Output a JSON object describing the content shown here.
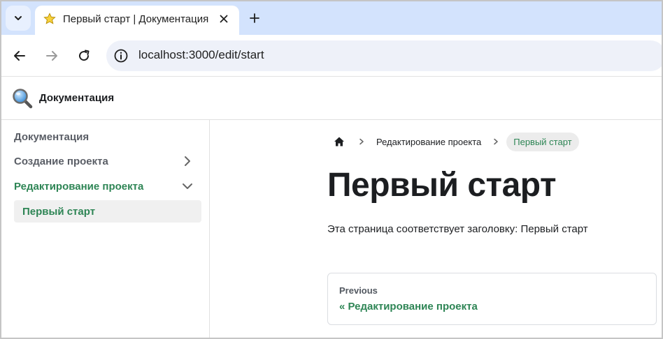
{
  "browser": {
    "tab": {
      "title": "Первый старт | Документация"
    },
    "url": "localhost:3000/edit/start"
  },
  "navbar": {
    "brand": "Документация"
  },
  "sidebar": {
    "items": [
      {
        "label": "Документация"
      },
      {
        "label": "Создание проекта",
        "caret": "chevron-right"
      },
      {
        "label": "Редактирование проекта",
        "caret": "chevron-down",
        "active": true
      }
    ],
    "sub_items": [
      {
        "label": "Первый старт",
        "active": true
      }
    ]
  },
  "breadcrumbs": {
    "items": [
      {
        "label": "Редактирование проекта"
      },
      {
        "label": "Первый старт",
        "active": true
      }
    ]
  },
  "page": {
    "title": "Первый старт",
    "text": "Эта страница соответствует заголовку: Первый старт"
  },
  "pager": {
    "sublabel": "Previous",
    "label": "« Редактирование проекта"
  },
  "colors": {
    "accent": "#2e8555",
    "tabstrip": "#d3e3fd",
    "omnibox": "#eef1f9"
  }
}
